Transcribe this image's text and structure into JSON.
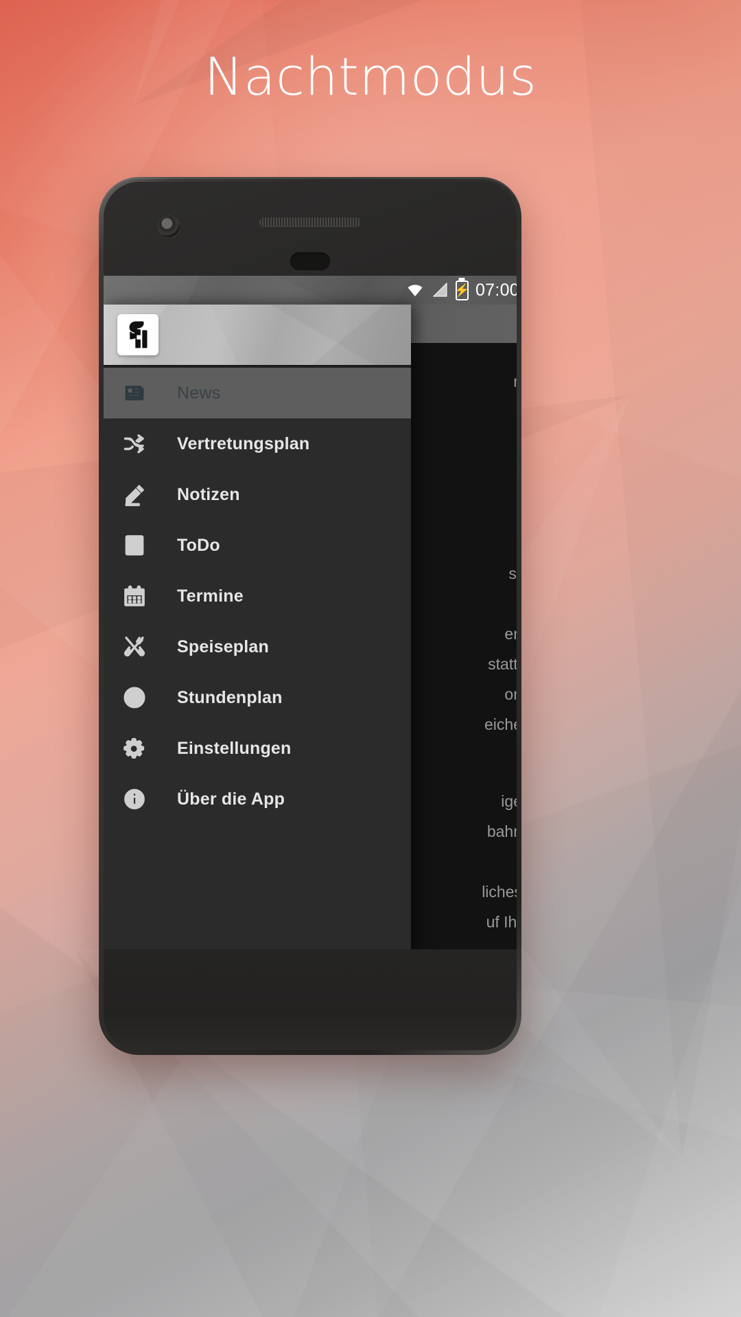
{
  "poster": {
    "headline": "Nachtmodus",
    "background_colors": {
      "top_left": "#d9503c",
      "mid": "#eda493",
      "bottom_right": "#dedede"
    },
    "headline_color": "#ffffff"
  },
  "phone": {
    "hardware": {
      "camera_icon": "front-camera",
      "earpiece_icon": "earpiece-speaker",
      "sensor_icon": "proximity-sensor"
    }
  },
  "statusbar": {
    "time": "07:00",
    "wifi_icon": "wifi-icon",
    "signal_icon": "cell-signal-icon",
    "battery_icon": "battery-charging-icon",
    "battery_glyph": "⚡",
    "background": "#5e5e5e"
  },
  "drawer": {
    "logo_name": "app-logo",
    "header_background": "#b6b6b6",
    "background": "#2b2b2b",
    "selected_background": "#5e5e5e",
    "items": [
      {
        "label": "News",
        "icon": "newspaper-icon",
        "selected": true
      },
      {
        "label": "Vertretungsplan",
        "icon": "shuffle-icon",
        "selected": false
      },
      {
        "label": "Notizen",
        "icon": "pencil-icon",
        "selected": false
      },
      {
        "label": "ToDo",
        "icon": "checklist-icon",
        "selected": false
      },
      {
        "label": "Termine",
        "icon": "calendar-icon",
        "selected": false
      },
      {
        "label": "Speiseplan",
        "icon": "cutlery-icon",
        "selected": false
      },
      {
        "label": "Stundenplan",
        "icon": "clock-icon",
        "selected": false
      },
      {
        "label": "Einstellungen",
        "icon": "gear-icon",
        "selected": false
      },
      {
        "label": "Über die  App",
        "icon": "info-icon",
        "selected": false
      }
    ]
  },
  "content": {
    "text_color": "#9a9a9a",
    "lines_top": "n",
    "lines_mid": "s\"\n\nen\nstatt.\non\neiche",
    "lines_bottom": "ige\nbahn\n\nliches\nuf Ihr"
  }
}
